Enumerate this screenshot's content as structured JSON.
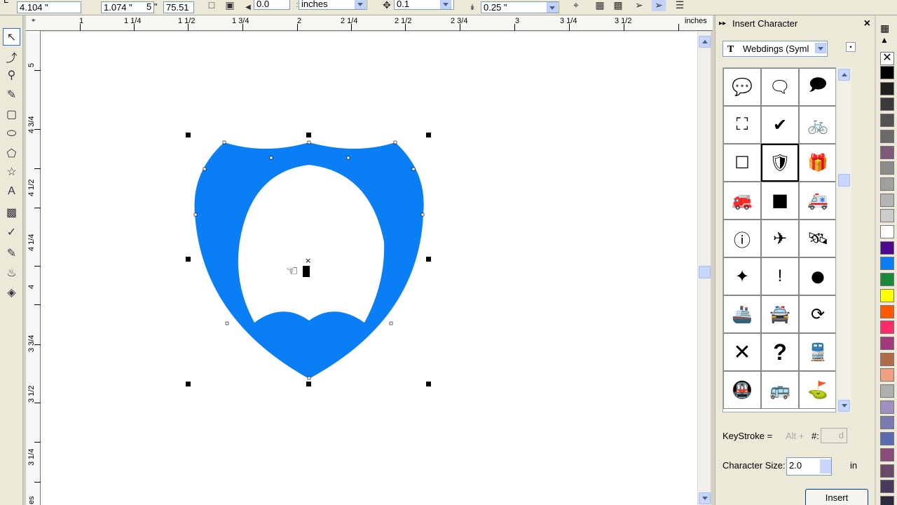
{
  "propbar": {
    "x_field": "4.104 \"",
    "x_label_frag": "L",
    "w_field": "1.074 \"",
    "h_frag": "5 \"",
    "scale_field": "75.51",
    "angle_field": "0.0",
    "units_value": "inches",
    "nudge_field": "0.1",
    "dup_y_field": "0.25 \""
  },
  "hruler": {
    "labels": [
      "1",
      "1 1/4",
      "1 1/2",
      "1 3/4",
      "2",
      "2 1/4",
      "2 1/2",
      "2 3/4",
      "3",
      "3 1/4",
      "3 1/2"
    ],
    "units": "inches"
  },
  "vruler": {
    "labels": [
      "5",
      "4 3/4",
      "4 1/2",
      "4 1/4",
      "4",
      "3 3/4",
      "3 1/2",
      "3 1/4",
      "3",
      "es"
    ]
  },
  "docker": {
    "title": "Insert Character",
    "font_name": "Webdings (Syml",
    "keystroke_label": "KeyStroke =",
    "alt_label": "Alt +",
    "hash_label": "#:",
    "keystroke_value": "d",
    "size_label": "Character Size:",
    "size_value": "2.0",
    "unit_label": "in",
    "insert_label": "Insert"
  },
  "glyph_icons": [
    "speech-bubble-icon",
    "speech-bubbles-icon",
    "speech-bubbles-three-icon",
    "frame-brackets-icon",
    "checkmark-icon",
    "bicycle-icon",
    "empty-square-icon",
    "shield-icon",
    "gift-box-icon",
    "fire-truck-icon",
    "filled-square-icon",
    "ambulance-icon",
    "info-circle-icon",
    "airplane-icon",
    "satellite-icon",
    "compass-star-icon",
    "exclamation-figure-icon",
    "filled-circle-icon",
    "ship-icon",
    "police-car-icon",
    "refresh-arrows-icon",
    "x-mark-icon",
    "question-mark-icon",
    "train-icon",
    "metro-sign-icon",
    "bus-icon",
    "golf-flag-icon"
  ],
  "shape": {
    "fill": "#0a7ff5"
  },
  "palette": [
    "#000000",
    "#1f1f1f",
    "#3a3a3a",
    "#525252",
    "#6a6a6a",
    "#7f5a78",
    "#8c8c8c",
    "#a0a0a0",
    "#b4b4b4",
    "#cccccc",
    "#ffffff",
    "#4a0a8a",
    "#0a7ff5",
    "#1a8a3a",
    "#ffff00",
    "#ff5a00",
    "#ff2a6a",
    "#a03a7a",
    "#b06a4a",
    "#f0a080",
    "#b0b0b0",
    "#a090c0",
    "#7a7ab0",
    "#5a6ab0",
    "#8a4a7a",
    "#6a4a6a",
    "#4a3a5a",
    "#2a2a3a"
  ]
}
